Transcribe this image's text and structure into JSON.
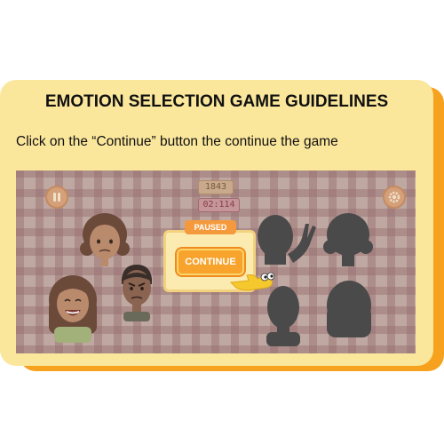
{
  "card": {
    "title": "EMOTION SELECTION GAME GUIDELINES",
    "instruction": "Click on the “Continue” button the continue the game"
  },
  "game": {
    "score": "1843",
    "timer": "02:114",
    "pause_icon": "pause-icon",
    "settings_icon": "gear-icon",
    "dialog": {
      "status": "PAUSED",
      "continue_label": "CONTINUE"
    },
    "pointer_icon": "hand-pointer-icon"
  },
  "colors": {
    "card_bg": "#fbe79c",
    "card_shadow": "#f6a21e",
    "continue_button": "#f7a32c",
    "paused_tab": "#f59a3c"
  }
}
